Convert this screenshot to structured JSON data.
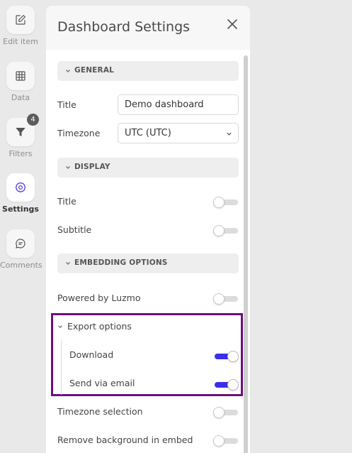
{
  "rail": {
    "items": [
      {
        "label": "Edit item",
        "icon": "edit-icon"
      },
      {
        "label": "Data",
        "icon": "table-icon"
      },
      {
        "label": "Filters",
        "icon": "filter-icon",
        "badge": "4"
      },
      {
        "label": "Settings",
        "icon": "gear-icon",
        "active": true
      },
      {
        "label": "Comments",
        "icon": "comment-icon"
      }
    ]
  },
  "panel": {
    "title": "Dashboard Settings",
    "sections": {
      "general": {
        "label": "GENERAL",
        "title_label": "Title",
        "title_value": "Demo dashboard",
        "timezone_label": "Timezone",
        "timezone_value": "UTC (UTC)"
      },
      "display": {
        "label": "DISPLAY",
        "title_label": "Title",
        "title_on": false,
        "subtitle_label": "Subtitle",
        "subtitle_on": false
      },
      "embedding": {
        "label": "EMBEDDING OPTIONS",
        "powered_label": "Powered by Luzmo",
        "powered_on": false,
        "export_label": "Export options",
        "download_label": "Download",
        "download_on": true,
        "email_label": "Send via email",
        "email_on": true,
        "timezone_selection_label": "Timezone selection",
        "timezone_selection_on": false,
        "remove_bg_label": "Remove background in embed",
        "remove_bg_on": false
      }
    }
  },
  "colors": {
    "toggle_on": "#3b2fe8",
    "highlight_border": "#6e0e7e",
    "active_icon": "#5b3fd6"
  }
}
